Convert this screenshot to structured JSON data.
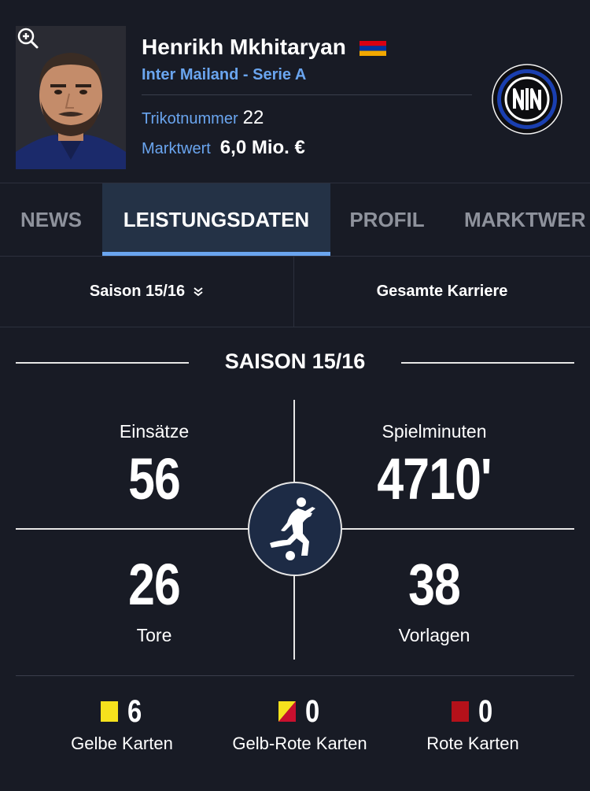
{
  "player": {
    "name": "Henrikh Mkhitaryan",
    "club_league": "Inter Mailand - Serie A",
    "shirt_number_label": "Trikotnummer",
    "shirt_number": "22",
    "market_value_label": "Marktwert",
    "market_value": "6,0 Mio. €",
    "flag_icon": "armenia-flag-icon",
    "club_logo_icon": "inter-milan-logo-icon"
  },
  "tabs": [
    {
      "label": "NEWS",
      "active": false
    },
    {
      "label": "LEISTUNGSDATEN",
      "active": true
    },
    {
      "label": "PROFIL",
      "active": false
    },
    {
      "label": "MARKTWER",
      "active": false
    }
  ],
  "selector": {
    "season_label": "Saison 15/16",
    "career_label": "Gesamte Karriere"
  },
  "section_title": "SAISON 15/16",
  "stats": {
    "appearances": {
      "label": "Einsätze",
      "value": "56"
    },
    "minutes": {
      "label": "Spielminuten",
      "value": "4710'"
    },
    "goals": {
      "label": "Tore",
      "value": "26"
    },
    "assists": {
      "label": "Vorlagen",
      "value": "38"
    }
  },
  "cards": {
    "yellow": {
      "label": "Gelbe Karten",
      "value": "6",
      "color": "#f5e11d"
    },
    "yellow_red": {
      "label": "Gelb-Rote Karten",
      "value": "0",
      "colors": [
        "#f5e11d",
        "#c8102e"
      ]
    },
    "red": {
      "label": "Rote Karten",
      "value": "0",
      "color": "#b4111a"
    }
  },
  "colors": {
    "background": "#181b25",
    "accent": "#6aa5ef",
    "active_tab_bg": "#243246"
  }
}
